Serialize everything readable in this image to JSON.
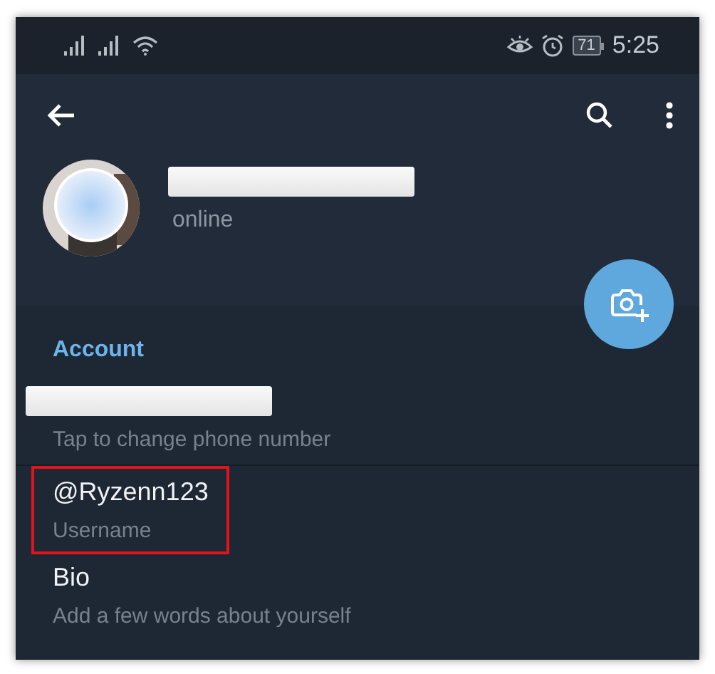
{
  "status_bar": {
    "battery": "71",
    "time": "5:25"
  },
  "profile": {
    "status": "online"
  },
  "section": {
    "title": "Account"
  },
  "items": [
    {
      "kind": "redacted",
      "subtitle": "Tap to change phone number",
      "highlighted": false
    },
    {
      "kind": "text",
      "title": "@Ryzenn123",
      "subtitle": "Username",
      "highlighted": true
    },
    {
      "kind": "text",
      "title": "Bio",
      "subtitle": "Add a few words about yourself",
      "highlighted": false
    }
  ]
}
